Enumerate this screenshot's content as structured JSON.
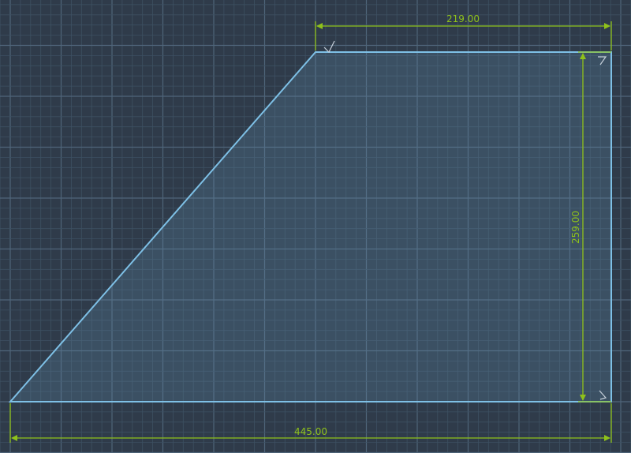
{
  "colors": {
    "background": "#2f3b4a",
    "grid_minor": "#3d5062",
    "grid_major": "#4f657a",
    "shape_stroke": "#7ec0e6",
    "shape_fill": "#5d88a6",
    "dimension": "#8fc21a",
    "corner_marker": "#c8d2dc"
  },
  "shape": {
    "type": "right-trapezoid",
    "units": "mm",
    "bottom_width": 445,
    "top_width": 219,
    "height": 259
  },
  "dimensions": {
    "top": "219.00",
    "right": "259.00",
    "bottom": "445.00"
  },
  "icons": {
    "corner_markers": [
      "corner-marker-icon",
      "corner-marker-icon",
      "corner-marker-icon"
    ]
  }
}
